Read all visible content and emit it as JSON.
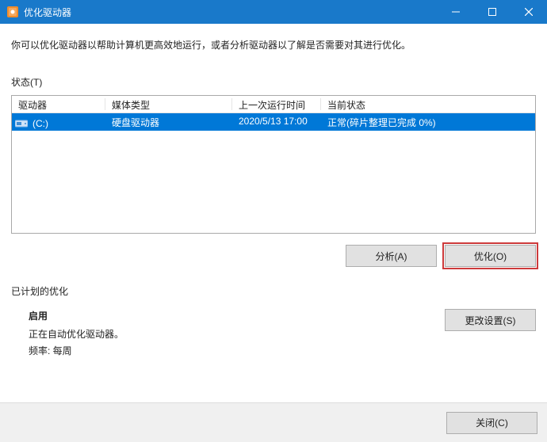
{
  "window": {
    "title": "优化驱动器"
  },
  "intro": "你可以优化驱动器以帮助计算机更高效地运行，或者分析驱动器以了解是否需要对其进行优化。",
  "status_label": "状态(T)",
  "columns": {
    "drive": "驱动器",
    "media": "媒体类型",
    "last_run": "上一次运行时间",
    "state": "当前状态"
  },
  "rows": [
    {
      "drive": "(C:)",
      "media": "硬盘驱动器",
      "last_run": "2020/5/13 17:00",
      "state": "正常(碎片整理已完成 0%)"
    }
  ],
  "buttons": {
    "analyze": "分析(A)",
    "optimize": "优化(O)",
    "change_settings": "更改设置(S)",
    "close": "关闭(C)"
  },
  "scheduled": {
    "section": "已计划的优化",
    "on": "启用",
    "desc": "正在自动优化驱动器。",
    "freq": "频率: 每周"
  }
}
